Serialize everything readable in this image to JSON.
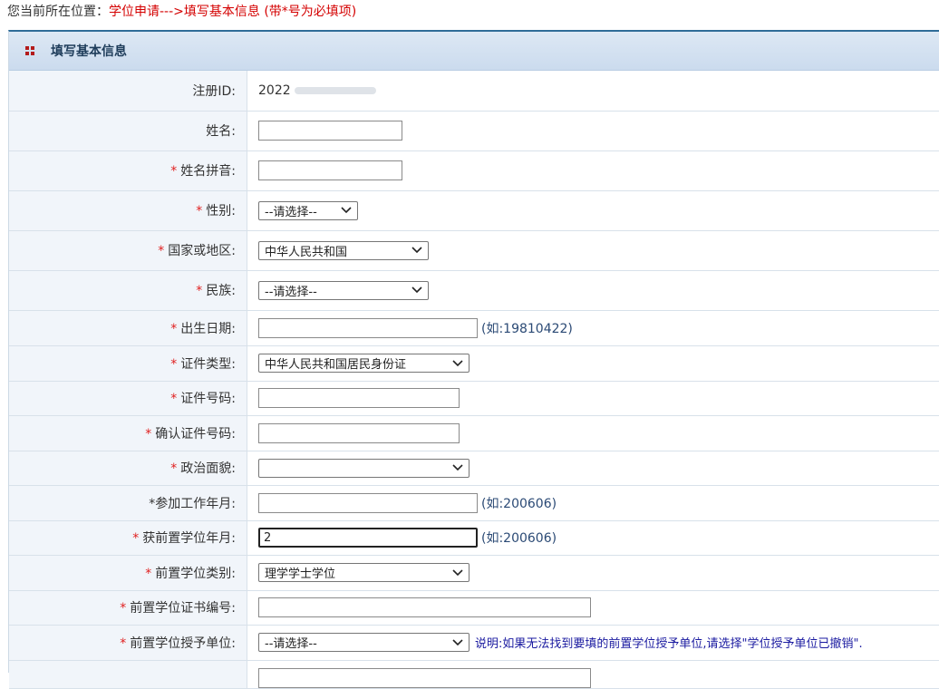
{
  "breadcrumb": {
    "prefix": "您当前所在位置：",
    "path": "学位申请--->填写基本信息 (带*号为必填项)"
  },
  "panel": {
    "title": "填写基本信息"
  },
  "form": {
    "star": "*",
    "registration_id": {
      "label": "注册ID:",
      "value": "2022"
    },
    "name": {
      "label": "姓名:",
      "value": ""
    },
    "name_pinyin": {
      "label": "姓名拼音:",
      "value": ""
    },
    "gender": {
      "label": "性别:",
      "selected": "--请选择--"
    },
    "country": {
      "label": "国家或地区:",
      "selected": "中华人民共和国"
    },
    "ethnicity": {
      "label": "民族:",
      "selected": "--请选择--"
    },
    "birth_date": {
      "label": "出生日期:",
      "value": "",
      "hint": "(如:19810422)"
    },
    "id_type": {
      "label": "证件类型:",
      "selected": "中华人民共和国居民身份证"
    },
    "id_number": {
      "label": "证件号码:",
      "value": ""
    },
    "id_confirm": {
      "label": "确认证件号码:",
      "value": ""
    },
    "political_status": {
      "label": "政治面貌:",
      "selected": ""
    },
    "work_start": {
      "label": "*参加工作年月:",
      "value": "",
      "hint": "(如:200606)"
    },
    "prior_degree_date": {
      "label": "获前置学位年月:",
      "value": "2",
      "hint": "(如:200606)"
    },
    "prior_degree_type": {
      "label": "前置学位类别:",
      "selected": "理学学士学位"
    },
    "prior_cert_no": {
      "label": "前置学位证书编号:",
      "value": ""
    },
    "prior_grantor": {
      "label": "前置学位授予单位:",
      "selected": "--请选择--",
      "note": "说明:如果无法找到要填的前置学位授予单位,请选择\"学位授予单位已撤销\"."
    }
  },
  "icons": {
    "panel_icon": "grid-icon",
    "dropdown": "chevron-down-icon"
  },
  "colors": {
    "accent_red": "#d40000",
    "header_blue": "#2f6c98",
    "label_bg": "#f1f5fa"
  }
}
